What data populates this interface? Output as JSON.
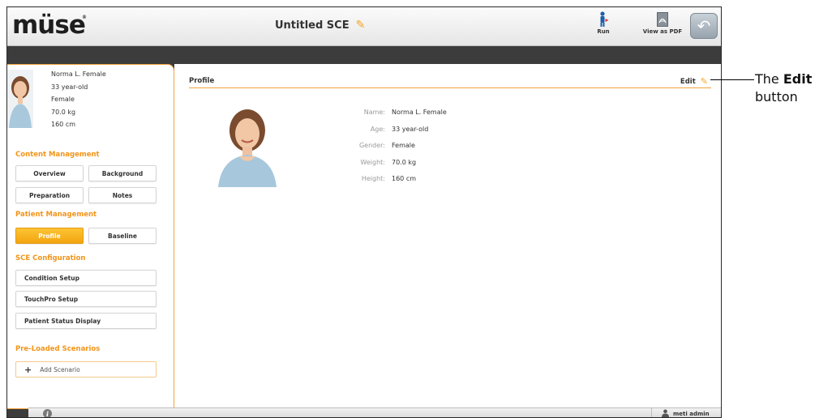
{
  "app": {
    "logo": "müse",
    "title": "Untitled SCE",
    "toolbar": {
      "run_label": "Run",
      "pdf_label": "View as PDF"
    }
  },
  "patient": {
    "name": "Norma L. Female",
    "age": "33 year-old",
    "gender": "Female",
    "weight": "70.0 kg",
    "height": "160 cm"
  },
  "sidebar": {
    "content_management": {
      "title": "Content Management",
      "overview": "Overview",
      "background": "Background",
      "preparation": "Preparation",
      "notes": "Notes"
    },
    "patient_management": {
      "title": "Patient Management",
      "profile": "Profile",
      "baseline": "Baseline"
    },
    "sce_configuration": {
      "title": "SCE Configuration",
      "condition_setup": "Condition Setup",
      "touchpro_setup": "TouchPro Setup",
      "patient_status_display": "Patient Status Display"
    },
    "preloaded": {
      "title": "Pre-Loaded Scenarios",
      "add_scenario": "Add Scenario"
    }
  },
  "main": {
    "section_title": "Profile",
    "edit_label": "Edit",
    "fields": {
      "name_label": "Name:",
      "age_label": "Age:",
      "gender_label": "Gender:",
      "weight_label": "Weight:",
      "height_label": "Height:"
    }
  },
  "footer": {
    "user": "meti admin"
  },
  "callout": {
    "prefix": "The",
    "bold": "Edit",
    "suffix": "button"
  },
  "colors": {
    "accent": "#f29418",
    "active_button": "#f5a91a"
  }
}
